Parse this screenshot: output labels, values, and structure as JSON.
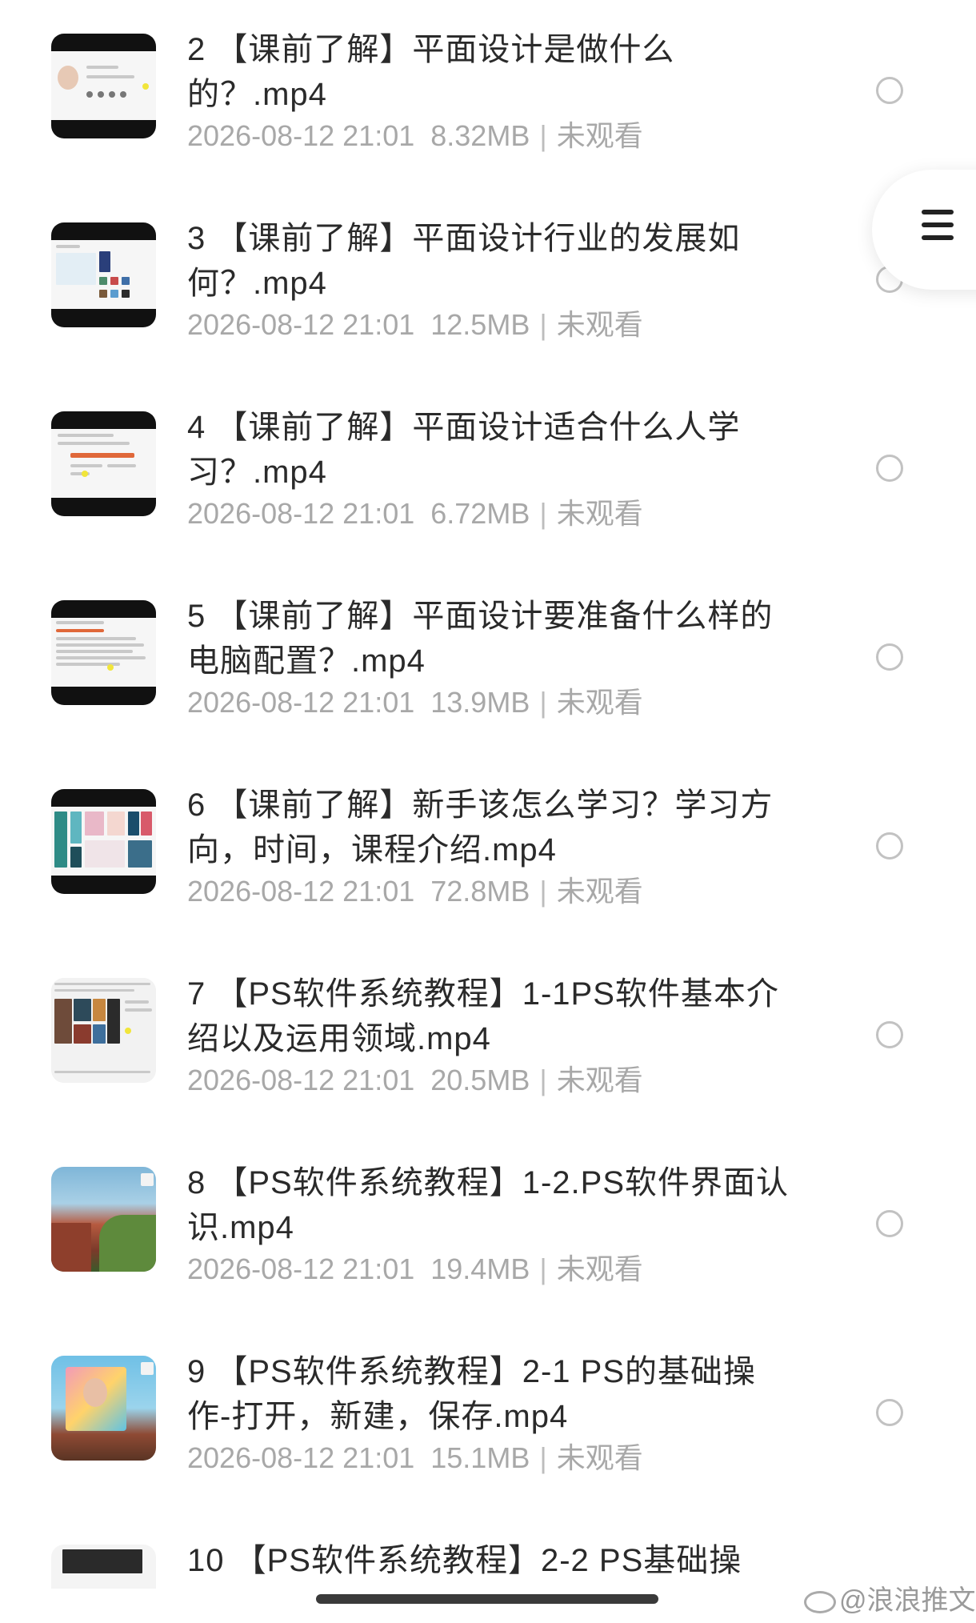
{
  "items": [
    {
      "title": "2 【课前了解】平面设计是做什么的？.mp4",
      "date": "2026-08-12 21:01",
      "size": "8.32MB",
      "status": "未观看",
      "thumb_icon": "video-thumbnail"
    },
    {
      "title": "3 【课前了解】平面设计行业的发展如何？.mp4",
      "date": "2026-08-12 21:01",
      "size": "12.5MB",
      "status": "未观看",
      "thumb_icon": "video-thumbnail"
    },
    {
      "title": "4 【课前了解】平面设计适合什么人学习？.mp4",
      "date": "2026-08-12 21:01",
      "size": "6.72MB",
      "status": "未观看",
      "thumb_icon": "video-thumbnail"
    },
    {
      "title": "5 【课前了解】平面设计要准备什么样的电脑配置？.mp4",
      "date": "2026-08-12 21:01",
      "size": "13.9MB",
      "status": "未观看",
      "thumb_icon": "video-thumbnail"
    },
    {
      "title": "6 【课前了解】新手该怎么学习？学习方向，时间，课程介绍.mp4",
      "date": "2026-08-12 21:01",
      "size": "72.8MB",
      "status": "未观看",
      "thumb_icon": "video-thumbnail"
    },
    {
      "title": "7 【PS软件系统教程】1-1PS软件基本介绍以及运用领域.mp4",
      "date": "2026-08-12 21:01",
      "size": "20.5MB",
      "status": "未观看",
      "thumb_icon": "video-thumbnail"
    },
    {
      "title": "8 【PS软件系统教程】1-2.PS软件界面认识.mp4",
      "date": "2026-08-12 21:01",
      "size": "19.4MB",
      "status": "未观看",
      "thumb_icon": "video-thumbnail"
    },
    {
      "title": "9 【PS软件系统教程】2-1 PS的基础操作-打开，新建，保存.mp4",
      "date": "2026-08-12 21:01",
      "size": "15.1MB",
      "status": "未观看",
      "thumb_icon": "video-thumbnail"
    },
    {
      "title": "10 【PS软件系统教程】2-2 PS基础操",
      "date": "",
      "size": "",
      "status": "",
      "thumb_icon": "video-thumbnail"
    }
  ],
  "menu_button_icon": "menu-icon",
  "watermark": "@浪浪推文"
}
